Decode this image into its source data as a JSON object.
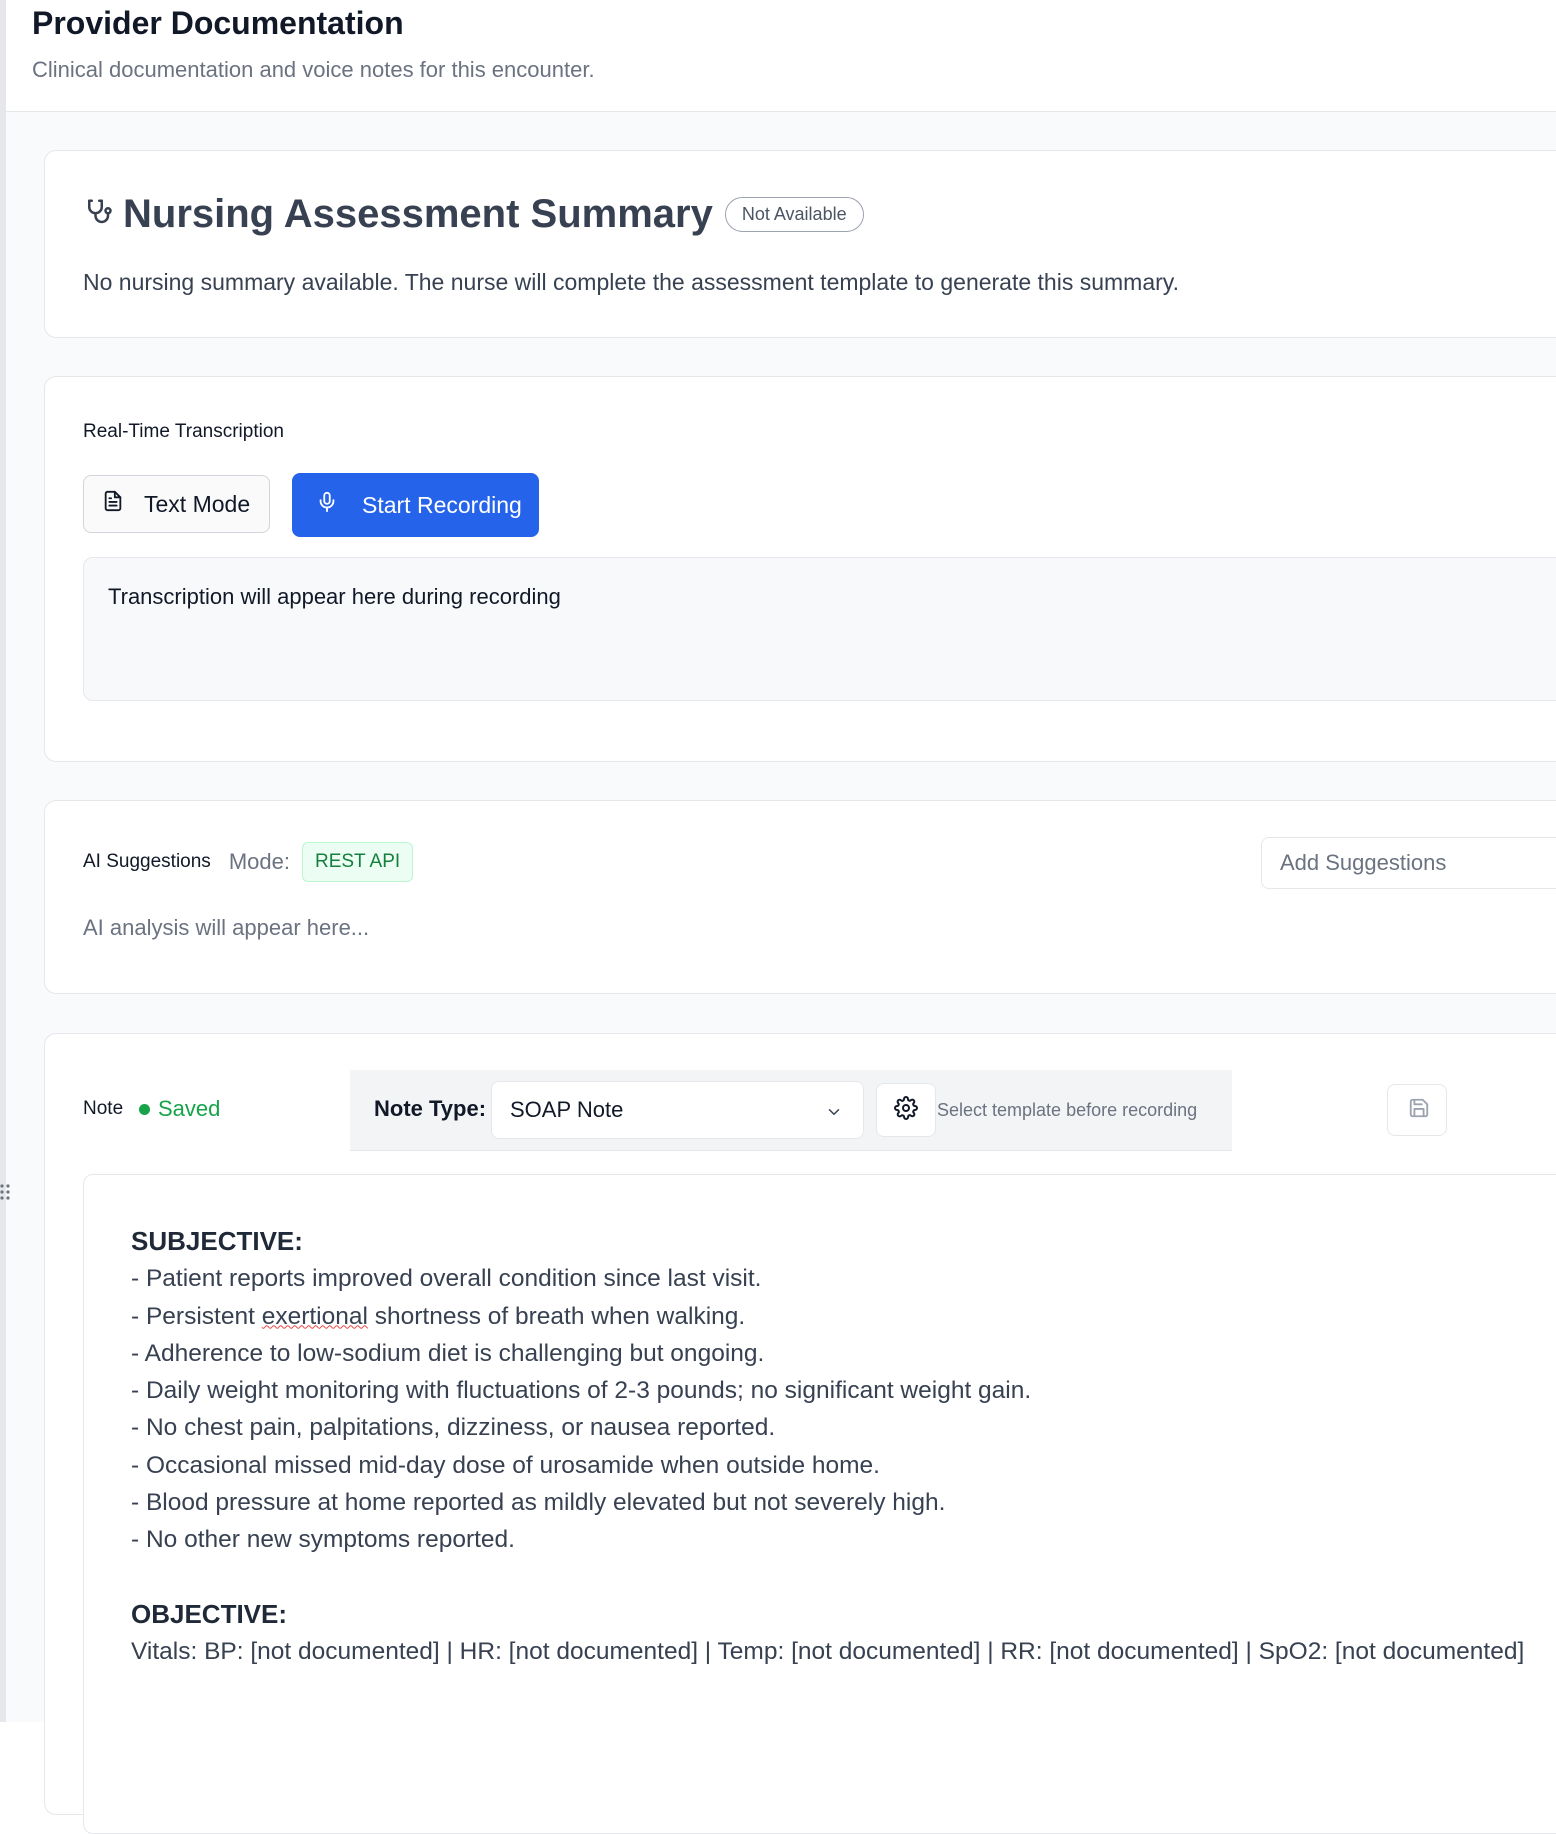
{
  "header": {
    "title": "Provider Documentation",
    "subtitle": "Clinical documentation and voice notes for this encounter."
  },
  "nursing": {
    "title": "Nursing Assessment Summary",
    "badge": "Not Available",
    "body": "No nursing summary available. The nurse will complete the assessment template to generate this summary."
  },
  "transcription": {
    "label": "Real-Time Transcription",
    "text_mode_label": "Text Mode",
    "record_label": "Start Recording",
    "placeholder": "Transcription will appear here during recording"
  },
  "ai": {
    "label": "AI Suggestions",
    "mode_label": "Mode:",
    "mode_value": "REST API",
    "add_button": "Add Suggestions",
    "placeholder": "AI analysis will appear here..."
  },
  "note": {
    "label": "Note",
    "status": "Saved",
    "note_type_label": "Note Type:",
    "note_type_value": "SOAP Note",
    "hint": "Select template before recording",
    "subjective_heading": "SUBJECTIVE:",
    "subjective_lines": [
      "- Patient reports improved overall condition since last visit.",
      "- Persistent exertional shortness of breath when walking.",
      "- Adherence to low-sodium diet is challenging but ongoing.",
      "- Daily weight monitoring with fluctuations of 2-3 pounds; no significant weight gain.",
      "- No chest pain, palpitations, dizziness, or nausea reported.",
      "- Occasional missed mid-day dose of urosamide when outside home.",
      "- Blood pressure at home reported as mildly elevated but not severely high.",
      "- No other new symptoms reported."
    ],
    "objective_heading": "OBJECTIVE:",
    "vitals_line": "Vitals: BP: [not documented] | HR: [not documented] | Temp: [not documented] | RR: [not documented] | SpO2: [not documented]"
  },
  "colors": {
    "primary": "#2563eb",
    "success": "#16a34a",
    "border": "#e5e7eb"
  },
  "icons": [
    "stethoscope-icon",
    "document-icon",
    "microphone-icon",
    "chevron-down-icon",
    "gear-icon",
    "save-icon",
    "drag-handle-icon"
  ]
}
